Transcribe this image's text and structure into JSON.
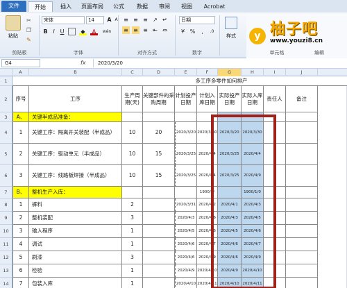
{
  "ribbon": {
    "tabs": [
      "文件",
      "开始",
      "插入",
      "页面布局",
      "公式",
      "数据",
      "审阅",
      "视图",
      "Acrobat"
    ],
    "paste_label": "粘贴",
    "clipboard_label": "剪贴板",
    "font_name": "宋体",
    "font_size": "14",
    "font_group_label": "字体",
    "align_group_label": "对齐方式",
    "number_format": "日期",
    "number_group_label": "数字",
    "styles_label": "样式",
    "cells_label": "单元格",
    "edit_label": "编辑",
    "bold": "B",
    "italic": "I",
    "underline": "U",
    "fill_label": "A",
    "wen": "wén"
  },
  "logo": {
    "letter": "y",
    "title": "柚子吧",
    "url": "www.youzi8.cn"
  },
  "formula_bar": {
    "cell_ref": "G4",
    "fx": "fx",
    "value": "2020/3/20"
  },
  "columns": [
    "A",
    "B",
    "C",
    "D",
    "E",
    "F",
    "G",
    "H",
    "I",
    "J"
  ],
  "sheet": {
    "title": "多工序多零件如何排产",
    "headers": {
      "a": "序号",
      "b": "工序",
      "c": "生产周期(天)",
      "d": "关键部件的采购周期",
      "e": "计划投产日期",
      "f": "计划入库日期",
      "g": "实际投产日期",
      "h": "实际入库日期",
      "i": "责任人",
      "j": "备注"
    },
    "rows": [
      {
        "row": "3",
        "a": "A、",
        "b": "关键半成品准备：",
        "yellow": true
      },
      {
        "row": "4",
        "a": "1",
        "b": "关键工序：隔离开关装配（半成品）",
        "c": "10",
        "d": "20",
        "e": "2020/3/20",
        "f": "2020/3/30",
        "g": "2020/3/20",
        "h": "2020/3/30"
      },
      {
        "row": "5",
        "a": "2",
        "b": "关键工序：驱动单元（半成品）",
        "c": "10",
        "d": "15",
        "e": "2020/3/25",
        "f": "2020/4/4",
        "g": "2020/3/25",
        "h": "2020/4/4"
      },
      {
        "row": "6",
        "a": "3",
        "b": "关键工序：线路板焊接（半成品）",
        "c": "10",
        "d": "15",
        "e": "2020/3/25",
        "f": "2020/4/4",
        "g": "2020/3/25",
        "h": "2020/4/9"
      },
      {
        "row": "7",
        "a": "B、",
        "b": "整机生产入库：",
        "f": "1900/1/",
        "h": "1900/1/0",
        "yellow": true
      },
      {
        "row": "8",
        "a": "1",
        "b": "裤料",
        "c": "2",
        "e": "2020/3/31",
        "f": "2020/4/2",
        "g": "2020/4/1",
        "h": "2020/4/3"
      },
      {
        "row": "9",
        "a": "2",
        "b": "整机装配",
        "c": "3",
        "e": "2020/4/3",
        "f": "2020/4/6",
        "g": "2020/4/3",
        "h": "2020/4/5"
      },
      {
        "row": "10",
        "a": "3",
        "b": "输入程序",
        "c": "1",
        "e": "2020/4/5",
        "f": "2020/4/6",
        "g": "2020/4/5",
        "h": "2020/4/6"
      },
      {
        "row": "11",
        "a": "4",
        "b": "调试",
        "c": "1",
        "e": "2020/4/6",
        "f": "2020/4/7",
        "g": "2020/4/6",
        "h": "2020/4/7"
      },
      {
        "row": "12",
        "a": "5",
        "b": "刷漆",
        "c": "3",
        "e": "2020/4/6",
        "f": "2020/4/9",
        "g": "2020/4/6",
        "h": "2020/4/9"
      },
      {
        "row": "13",
        "a": "6",
        "b": "检验",
        "c": "1",
        "e": "2020/4/9",
        "f": "2020/4/10",
        "g": "2020/4/9",
        "h": "2020/4/10"
      },
      {
        "row": "14",
        "a": "7",
        "b": "包装入库",
        "c": "1",
        "e": "2020/4/10",
        "f": "2020/4/11",
        "g": "2020/4/10",
        "h": "2020/4/11"
      }
    ]
  },
  "colors": {
    "yellow": "#ffff00",
    "blue": "#bdd7ee",
    "red_box": "#a0221b",
    "file_tab": "#2e6fc0"
  }
}
